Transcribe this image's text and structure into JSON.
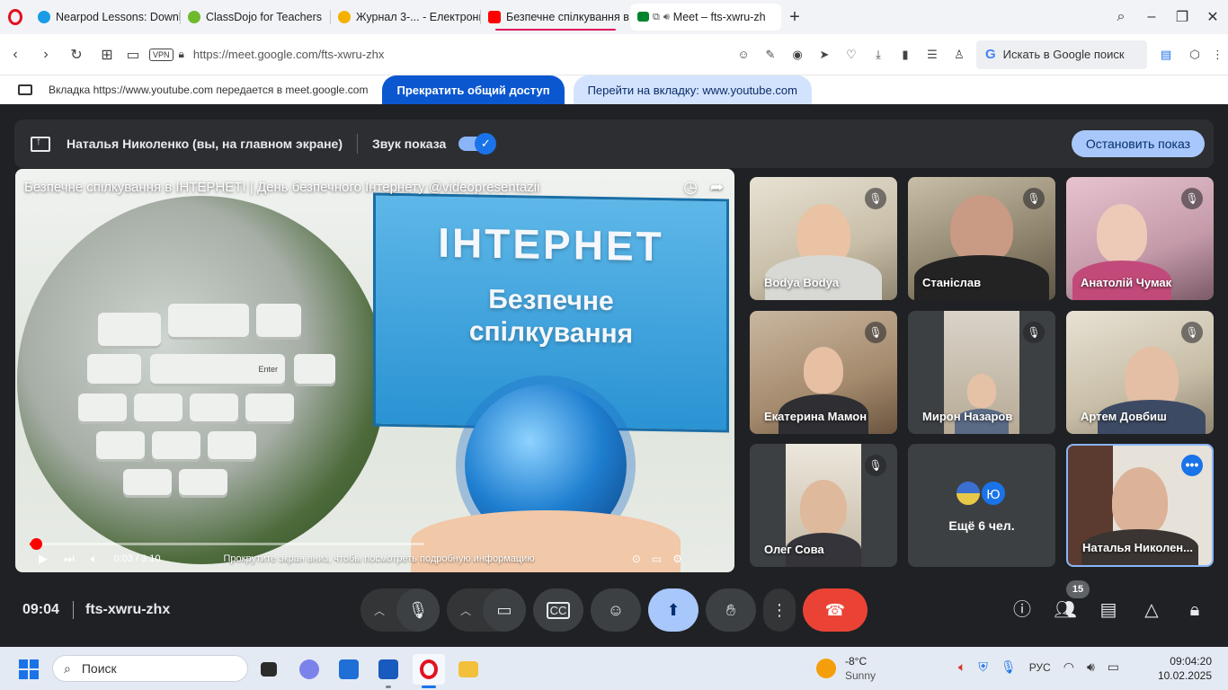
{
  "browser": {
    "tabs": [
      {
        "label": "Nearpod Lessons: Downlo",
        "favicon_color": "#1a9be8"
      },
      {
        "label": "ClassDojo for Teachers",
        "favicon_color": "#6fba2c"
      },
      {
        "label": "Журнал 3-... - Електронні",
        "favicon_color": "#f5b100"
      },
      {
        "label": "Безпечне спілкування в І",
        "favicon_color": "#ff0000"
      },
      {
        "label": "Meet – fts-xwru-zh",
        "favicon_color": "#00832d"
      }
    ],
    "url": "https://meet.google.com/fts-xwru-zhx",
    "vpn_label": "VPN",
    "search_placeholder": "Искать в Google поиск"
  },
  "share_bar": {
    "text": "Вкладка https://www.youtube.com передается в meet.google.com",
    "stop_label": "Прекратить общий доступ",
    "switch_label": "Перейти на вкладку: www.youtube.com"
  },
  "meet": {
    "presenting_name": "Наталья Николенко (вы, на главном экране)",
    "sound_label": "Звук показа",
    "sound_enabled": true,
    "stop_presenting_label": "Остановить показ",
    "video": {
      "title": "Безпечне спілкування в ІНТЕРНЕТІ | День безпечного Інтернету @videopresentazii",
      "screen_heading": "ІНТЕРНЕТ",
      "screen_sub1": "Безпечне",
      "screen_sub2": "спілкування",
      "key_enter": "Enter",
      "time": "0:03 / 3:10",
      "progress_fraction": 0.016,
      "scroll_hint": "Прокрутите экран вниз, чтобы посмотреть подробную информацию"
    },
    "participants": [
      {
        "name": "Bodya Bodya",
        "muted": true
      },
      {
        "name": "Станіслав",
        "muted": true
      },
      {
        "name": "Анатолій Чумак",
        "muted": true
      },
      {
        "name": "Екатерина Мамон",
        "muted": true
      },
      {
        "name": "Мирон Назаров",
        "muted": true
      },
      {
        "name": "Артем Довбиш",
        "muted": true
      },
      {
        "name": "Олег Сова",
        "muted": true
      }
    ],
    "more_tile": {
      "avatar_letter": "Ю",
      "label": "Ещё 6 чел."
    },
    "self_tile": {
      "name": "Наталья Николен..."
    },
    "time": "09:04",
    "meeting_code": "fts-xwru-zhx",
    "people_count": "15"
  },
  "taskbar": {
    "search_placeholder": "Поиск",
    "weather_temp": "-8°C",
    "weather_desc": "Sunny",
    "language": "РУС",
    "clock_time": "09:04:20",
    "clock_date": "10.02.2025"
  }
}
